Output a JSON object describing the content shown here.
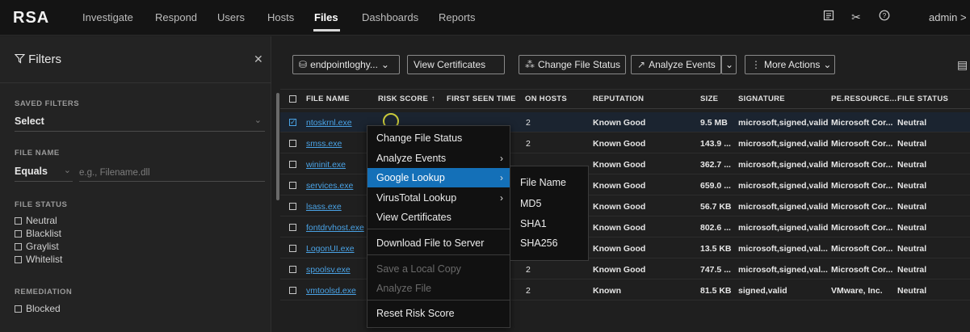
{
  "nav": {
    "logo": "RSA",
    "items": [
      "Investigate",
      "Respond",
      "Users",
      "Hosts",
      "Files",
      "Dashboards",
      "Reports"
    ],
    "active": "Files",
    "user": "admin >"
  },
  "filters": {
    "title": "Filters",
    "saved_filters_label": "SAVED FILTERS",
    "saved_filters_value": "Select",
    "file_name_label": "FILE NAME",
    "file_name_operator": "Equals",
    "file_name_placeholder": "e.g., Filename.dll",
    "file_status_label": "FILE STATUS",
    "file_status_options": [
      "Neutral",
      "Blacklist",
      "Graylist",
      "Whitelist"
    ],
    "remediation_label": "REMEDIATION",
    "remediation_options": [
      "Blocked"
    ]
  },
  "toolbar": {
    "source": "endpointloghy...",
    "view_certificates": "View Certificates",
    "change_file_status": "Change File Status",
    "analyze_events": "Analyze Events",
    "more_actions": "More Actions"
  },
  "table": {
    "columns": [
      "FILE NAME",
      "RISK SCORE",
      "FIRST SEEN TIME",
      "ON HOSTS",
      "REPUTATION",
      "SIZE",
      "SIGNATURE",
      "PE.RESOURCE...",
      "FILE STATUS"
    ],
    "sort_indicator": "↑",
    "rows": [
      {
        "name": "ntoskrnl.exe",
        "hosts": "2",
        "reputation": "Known Good",
        "size": "9.5 MB",
        "signature": "microsoft,signed,valid",
        "resource": "Microsoft Cor...",
        "status": "Neutral",
        "selected": true
      },
      {
        "name": "smss.exe",
        "hosts": "2",
        "reputation": "Known Good",
        "size": "143.9 ...",
        "signature": "microsoft,signed,valid",
        "resource": "Microsoft Cor...",
        "status": "Neutral"
      },
      {
        "name": "wininit.exe",
        "hosts": "",
        "reputation": "Known Good",
        "size": "362.7 ...",
        "signature": "microsoft,signed,valid",
        "resource": "Microsoft Cor...",
        "status": "Neutral"
      },
      {
        "name": "services.exe",
        "hosts": "",
        "reputation": "Known Good",
        "size": "659.0 ...",
        "signature": "microsoft,signed,valid",
        "resource": "Microsoft Cor...",
        "status": "Neutral"
      },
      {
        "name": "lsass.exe",
        "hosts": "",
        "reputation": "Known Good",
        "size": "56.7 KB",
        "signature": "microsoft,signed,valid",
        "resource": "Microsoft Cor...",
        "status": "Neutral"
      },
      {
        "name": "fontdrvhost.exe",
        "hosts": "",
        "reputation": "Known Good",
        "size": "802.6 ...",
        "signature": "microsoft,signed,valid",
        "resource": "Microsoft Cor...",
        "status": "Neutral"
      },
      {
        "name": "LogonUI.exe",
        "hosts": "2",
        "reputation": "Known Good",
        "size": "13.5 KB",
        "signature": "microsoft,signed,val...",
        "resource": "Microsoft Cor...",
        "status": "Neutral"
      },
      {
        "name": "spoolsv.exe",
        "hosts": "2",
        "reputation": "Known Good",
        "size": "747.5 ...",
        "signature": "microsoft,signed,val...",
        "resource": "Microsoft Cor...",
        "status": "Neutral"
      },
      {
        "name": "vmtoolsd.exe",
        "hosts": "2",
        "reputation": "Known",
        "size": "81.5 KB",
        "signature": "signed,valid",
        "resource": "VMware, Inc.",
        "status": "Neutral"
      }
    ]
  },
  "context_menu": {
    "items": [
      "Change File Status",
      "Analyze Events",
      "Google Lookup",
      "VirusTotal Lookup",
      "View Certificates",
      "Download File to Server",
      "Save a Local Copy",
      "Analyze File",
      "Reset Risk Score"
    ],
    "highlighted": "Google Lookup",
    "disabled": [
      "Save a Local Copy",
      "Analyze File"
    ]
  },
  "submenu": {
    "items": [
      "File Name",
      "MD5",
      "SHA1",
      "SHA256"
    ]
  },
  "colors": {
    "accent": "#1470b8",
    "link": "#4aa3e6",
    "background": "#1f1f1f"
  }
}
